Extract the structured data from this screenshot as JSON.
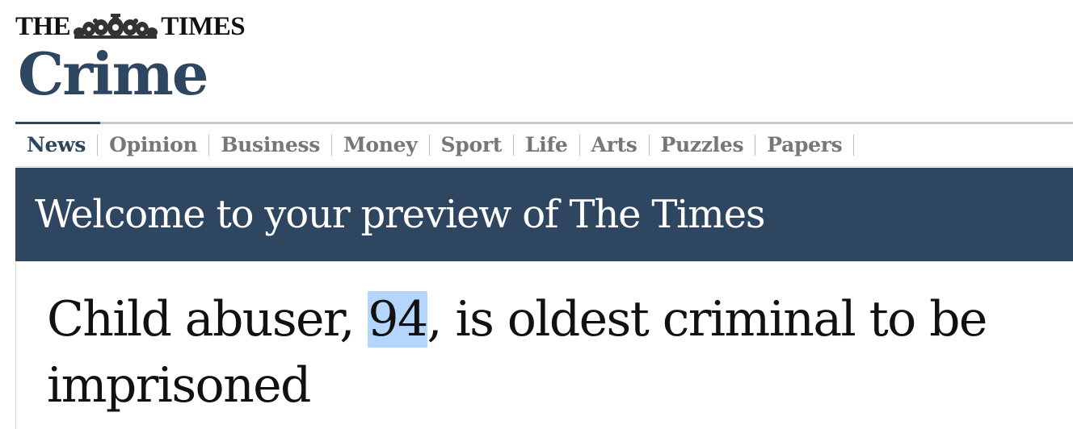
{
  "masthead": {
    "left": "THE",
    "right": "TIMES",
    "crest_icon": "royal-crest-icon"
  },
  "section": {
    "title": "Crime"
  },
  "nav": {
    "items": [
      "News",
      "Opinion",
      "Business",
      "Money",
      "Sport",
      "Life",
      "Arts",
      "Puzzles",
      "Papers"
    ],
    "active": "News"
  },
  "banner": {
    "text": "Welcome to your preview of The Times"
  },
  "article": {
    "headline_before": "Child abuser, ",
    "headline_selected": "94",
    "headline_after": ", is oldest criminal to be imprisoned"
  },
  "colors": {
    "brand": "#2f4661",
    "selection": "#b4d5fe",
    "nav_text": "#777777"
  }
}
